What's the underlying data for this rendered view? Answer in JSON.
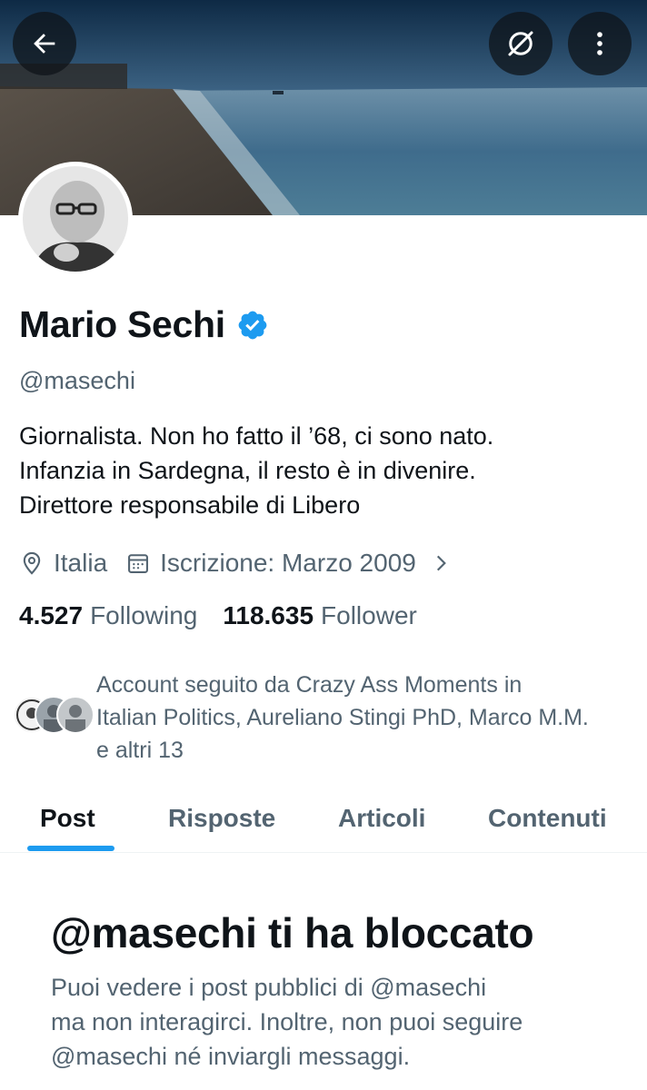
{
  "header": {
    "back_icon": "arrow-left-icon",
    "mute_icon": "hide-circle-icon",
    "more_icon": "more-vertical-icon"
  },
  "profile": {
    "name": "Mario Sechi",
    "verified": true,
    "handle": "@masechi",
    "bio_lines": [
      "Giornalista. Non ho fatto il ’68, ci sono nato.",
      "Infanzia in Sardegna, il resto è in divenire.",
      "Direttore responsabile di Libero"
    ],
    "location": "Italia",
    "joined": "Iscrizione: Marzo 2009",
    "following_count": "4.527",
    "following_label": "Following",
    "follower_count": "118.635",
    "follower_label": "Follower",
    "followed_by_lines": [
      "Account seguito da Crazy Ass Moments in",
      "Italian Politics, Aureliano Stingi PhD, Marco M.M.",
      "e altri 13"
    ]
  },
  "tabs": [
    "Post",
    "Risposte",
    "Articoli",
    "Contenuti"
  ],
  "active_tab": "Post",
  "blocked": {
    "title": "@masechi ti ha bloccato",
    "text_lines": [
      "Puoi vedere i post pubblici di @masechi",
      "ma non interagirci. Inoltre, non puoi seguire",
      "@masechi né inviargli messaggi."
    ]
  },
  "colors": {
    "accent": "#1d9bf0",
    "text_primary": "#0f1419",
    "text_secondary": "#536471"
  }
}
